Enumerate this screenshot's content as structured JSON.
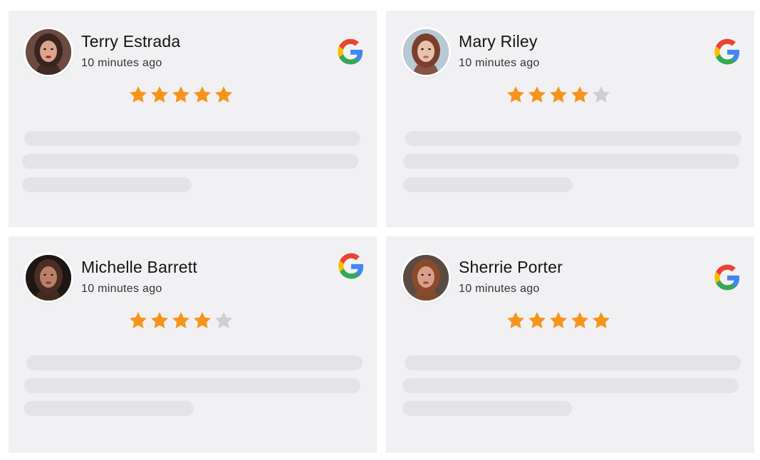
{
  "reviews": [
    {
      "name": "Terry Estrada",
      "time": "10 minutes ago",
      "rating": 5,
      "max_rating": 5,
      "source_icon": "google-icon",
      "avatar_colors": {
        "bg": "#6b4a42",
        "hair": "#3a2420",
        "skin": "#d9a48e",
        "lips": "#c0192b"
      }
    },
    {
      "name": "Mary Riley",
      "time": "10 minutes ago",
      "rating": 4,
      "max_rating": 5,
      "source_icon": "google-icon",
      "avatar_colors": {
        "bg": "#b9c9d4",
        "hair": "#7a3f2a",
        "skin": "#e9c2ac",
        "lips": "#b06b5c"
      }
    },
    {
      "name": "Michelle Barrett",
      "time": "10 minutes ago",
      "rating": 4,
      "max_rating": 5,
      "source_icon": "google-icon",
      "avatar_colors": {
        "bg": "#1d1614",
        "hair": "#4a2e22",
        "skin": "#b8806a",
        "lips": "#8c3c34"
      }
    },
    {
      "name": "Sherrie Porter",
      "time": "10 minutes ago",
      "rating": 5,
      "max_rating": 5,
      "source_icon": "google-icon",
      "avatar_colors": {
        "bg": "#5a4a44",
        "hair": "#8a4a2e",
        "skin": "#d8a08a",
        "lips": "#a04a40"
      }
    }
  ],
  "colors": {
    "card_background": "#f1f1f3",
    "placeholder_bar": "#e4e4e6",
    "star_filled": "#f7941d",
    "star_empty": "#cfcfd1",
    "google_blue": "#4285F4",
    "google_red": "#EA4335",
    "google_yellow": "#FBBC05",
    "google_green": "#34A853"
  }
}
